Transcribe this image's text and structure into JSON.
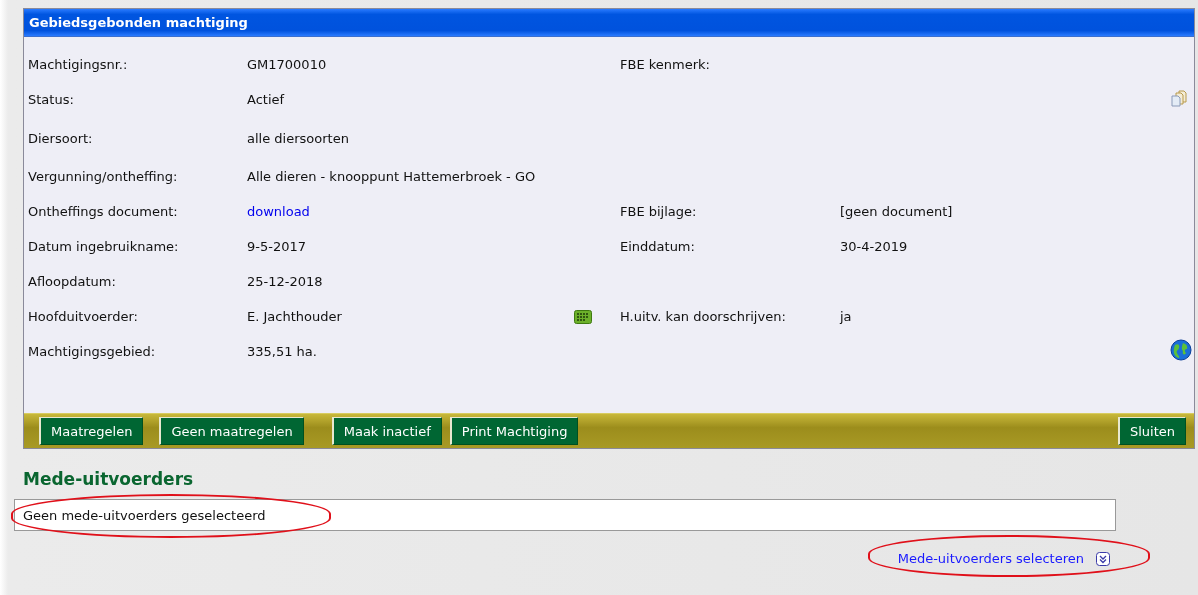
{
  "panel": {
    "title": "Gebiedsgebonden machtiging",
    "rows": [
      {
        "label": "Machtigingsnr.:",
        "value": "GM1700010",
        "kind": "text",
        "right_label": "FBE kenmerk:"
      },
      {
        "label": "Status:",
        "value": "Actief",
        "kind": "text"
      },
      {
        "label": "Diersoort:",
        "value": "alle diersoorten",
        "kind": "text"
      },
      {
        "label": "Vergunning/ontheffing:",
        "value": "Alle dieren - knooppunt Hattemerbroek - GO",
        "kind": "text"
      },
      {
        "label": "Ontheffings document:",
        "value": "download",
        "kind": "link",
        "right_label": "FBE bijlage:",
        "right_value": "[geen document]"
      },
      {
        "label": "Datum ingebruikname:",
        "value": "9-5-2017",
        "kind": "text",
        "right_label": "Einddatum:",
        "right_value": "30-4-2019"
      },
      {
        "label": "Afloopdatum:",
        "value": "25-12-2018",
        "kind": "text"
      },
      {
        "label": "Hoofduitvoerder:",
        "value": "E. Jachthouder",
        "kind": "text",
        "right_label": "H.uitv. kan doorschrijven:",
        "right_value": "ja"
      },
      {
        "label": "Machtigingsgebied:",
        "value": "335,51 ha.",
        "kind": "text"
      }
    ],
    "buttons": [
      "Maatregelen",
      "Geen maatregelen",
      "Maak inactief",
      "Print Machtiging"
    ],
    "close_button": "Sluiten"
  },
  "co_executors": {
    "heading": "Mede-uitvoerders",
    "value": "Geen mede-uitvoerders geselecteerd",
    "value_highlighted": true,
    "select_link": "Mede-uitvoerders selecteren",
    "link_highlighted": true
  }
}
